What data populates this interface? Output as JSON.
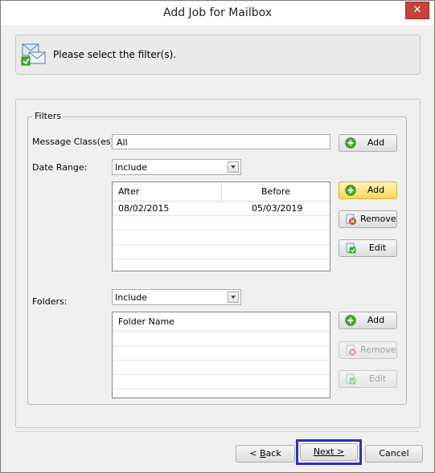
{
  "window": {
    "title": "Add Job for Mailbox",
    "close_glyph": "✕"
  },
  "header": {
    "text": "Please select the filter(s).",
    "icon": "mailbox-filter-icon"
  },
  "filters": {
    "group_title": "Filters",
    "message_class": {
      "label": "Message Class(es):",
      "value": "All",
      "add_label": "Add"
    },
    "date_range": {
      "label": "Date Range:",
      "mode": "Include",
      "columns": [
        "After",
        "Before"
      ],
      "rows": [
        {
          "after": "08/02/2015",
          "before": "05/03/2019"
        }
      ],
      "add_label": "Add",
      "remove_label": "Remove",
      "edit_label": "Edit"
    },
    "folders": {
      "label": "Folders:",
      "mode": "Include",
      "column": "Folder Name",
      "add_label": "Add",
      "remove_label": "Remove",
      "edit_label": "Edit"
    }
  },
  "footer": {
    "back_label_prefix": "< ",
    "back_label_key": "B",
    "back_label_rest": "ack",
    "next_label_key": "N",
    "next_label_rest": "ext >",
    "cancel_label": "Cancel"
  },
  "colors": {
    "focus": "#2e2ec8",
    "add_icon": "#3fae2a",
    "remove_icon": "#d33a2c",
    "close": "#c7433b"
  }
}
